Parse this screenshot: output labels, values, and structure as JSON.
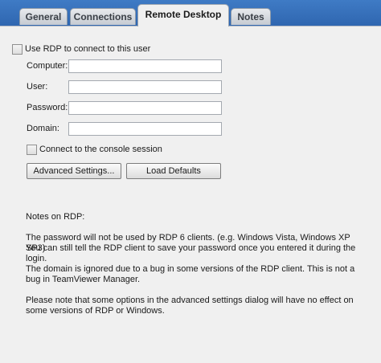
{
  "tabs": [
    {
      "label": "General"
    },
    {
      "label": "Connections"
    },
    {
      "label": "Remote Desktop"
    },
    {
      "label": "Notes"
    }
  ],
  "active_tab": "Remote Desktop",
  "rdp": {
    "use_rdp_label": "Use RDP to connect to this user",
    "use_rdp_checked": false,
    "fields": {
      "computer_label": "Computer:",
      "computer_value": "",
      "user_label": "User:",
      "user_value": "",
      "password_label": "Password:",
      "password_value": "",
      "domain_label": "Domain:",
      "domain_value": ""
    },
    "console_label": "Connect to the console session",
    "console_checked": false,
    "advanced_button": "Advanced Settings...",
    "defaults_button": "Load Defaults"
  },
  "notes": {
    "heading": "Notes on RDP:",
    "p1_line1": "The password will not be used by RDP 6 clients. (e.g. Windows Vista, Windows XP SP3)",
    "p1_line2": "You can still tell the RDP client to save your password once you entered it during the login.",
    "p2": "The domain is ignored due to a bug in some versions of the RDP client. This is not a bug in TeamViewer Manager.",
    "p3": "Please note that some options in the advanced settings dialog will have no effect on some versions of RDP or Windows."
  }
}
